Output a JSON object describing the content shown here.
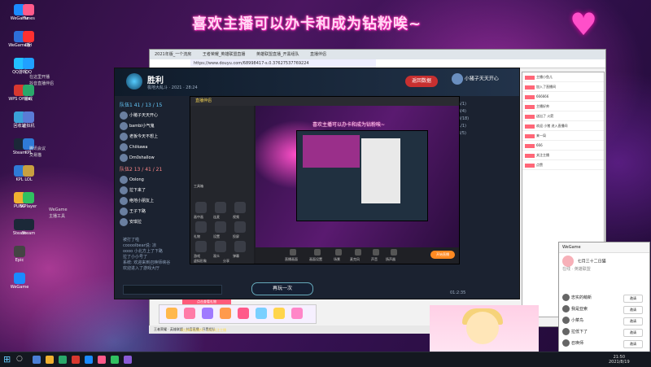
{
  "desktop": {
    "icons_col1": [
      "WeGame",
      "WeGame版",
      "QQ游戏",
      "WPS Office",
      "回收站",
      "Steam",
      "KPL",
      "PUBG",
      "Steam",
      "Epic",
      "WeGame"
    ],
    "icons_col2": [
      "iTunes",
      "Ctrl",
      "QQ",
      "游戏",
      "虚拟机",
      "KPL",
      "LOL",
      "ViPlayer",
      "Steam"
    ],
    "notes": [
      "在这里开播",
      "抖音直播伴侣",
      "腾讯会议",
      "交易猫",
      "WeGame",
      "主播工具"
    ]
  },
  "banner": "喜欢主播可以办卡和成为钻粉唉~",
  "heart_glyph": "♥",
  "browser": {
    "tabs": [
      "2021年版_一个流房",
      "王者荣耀_英雄联盟直播",
      "英雄联盟直播_开黑组队",
      "直播伴侣"
    ],
    "url": "https://www.douyu.com/68998417-s.0.37627537769224"
  },
  "game": {
    "title": "胜利",
    "subtitle": "极地大乱斗 · 2021 · 28:24",
    "reward_button": "返回数据",
    "player_name": "小猪子天天开心",
    "team_blue_label": "队伍1  41 / 13 / 15",
    "team_red_label": "队伍2  13 / 41 / 21",
    "team_blue": [
      "小猪子天天开心",
      "bambi小气鬼",
      "老板今天不想上",
      "Chiikawa",
      "Dm0shallow"
    ],
    "team_red": [
      "Oolong",
      "拉下来了",
      "绝地小朋友上",
      "王子下路",
      "安琪拉"
    ],
    "chat": [
      "被打了啦",
      "coooolbear说: 凉",
      "oooo 小北方上了下路",
      "拉了小小号了",
      "系统: 欢迎来到召唤师峡谷",
      "欢迎进入了游戏大厅"
    ],
    "again_button": "再玩一次",
    "right_list": [
      "(5/1)",
      "(0/4)",
      "(0/18)",
      "(1/1)",
      "(3/5)"
    ],
    "bottom_time": "01:2:35"
  },
  "capture": {
    "brand": "直播伴侣",
    "banner": "喜欢主播可以办卡和成为钻粉唉~",
    "tools": [
      "工具箱",
      "画中画",
      "连麦",
      "视频",
      "礼物",
      "设置",
      "投屏",
      "游戏",
      "观众",
      "弹幕",
      "虚拟形象",
      "分享"
    ],
    "bar": [
      "直播画面",
      "画面设置",
      "场景",
      "麦克风",
      "声音",
      "扬声器"
    ],
    "live_button": "开始直播"
  },
  "right_chat": {
    "rows": [
      "主播小鱼儿",
      "加入了直播间",
      "666666",
      "主播好帅",
      "送出了 火箭",
      "欢迎 小猪 进入直播间",
      "来一局",
      "666",
      "关注主播",
      "点赞"
    ]
  },
  "wegame": {
    "header": "WeGame",
    "user_name": "七月三十二日猫",
    "user_sub": "在线 · 英雄联盟",
    "friends": [
      "忠实的萌新",
      "我是亚索",
      "小菜鸟",
      "拉低下了",
      "召唤师"
    ],
    "friend_btn": "邀请"
  },
  "gift_promo": "点击查看礼物",
  "ticker": "欢迎来到直播间，点击关注主播",
  "strip_text": "王者荣耀 · 英雄联盟 · 抖音直播 · 开黑组队",
  "taskbar": {
    "time": "21:50",
    "date": "2021/8/19"
  },
  "colors": {
    "banner_glow": "#ff3fb5",
    "heart": "#ff4fc9",
    "live_button": "#ff8a22",
    "cw_button": "#c83030"
  }
}
